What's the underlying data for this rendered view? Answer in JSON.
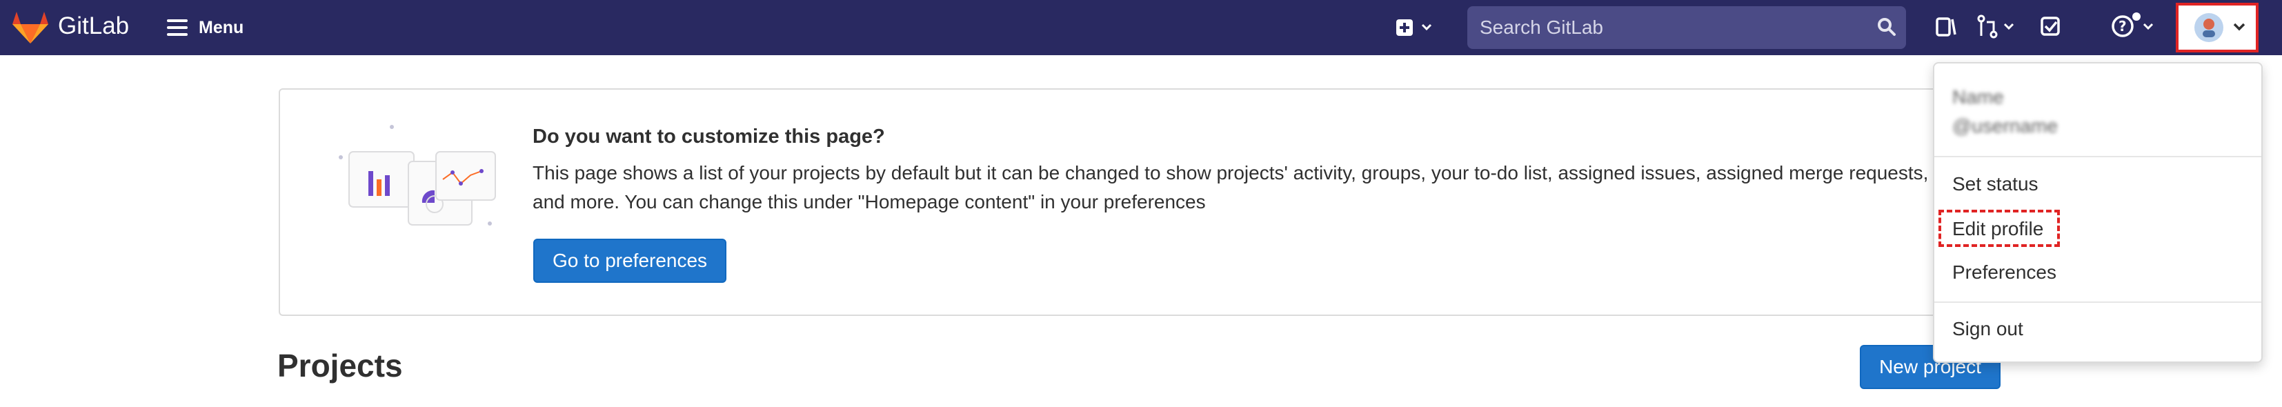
{
  "topbar": {
    "logo_text": "GitLab",
    "menu_label": "Menu",
    "search_placeholder": "Search GitLab"
  },
  "banner": {
    "title": "Do you want to customize this page?",
    "body": "This page shows a list of your projects by default but it can be changed to show projects' activity, groups, your to-do list, assigned issues, assigned merge requests, and more. You can change this under \"Homepage content\" in your preferences",
    "button_label": "Go to preferences"
  },
  "main": {
    "projects_title": "Projects",
    "new_project_label": "New project"
  },
  "user_dropdown": {
    "name": "Name",
    "username": "@username",
    "items": [
      "Set status",
      "Edit profile",
      "Preferences",
      "Sign out"
    ]
  },
  "colors": {
    "topbar": "#292961",
    "primary": "#1f75cb",
    "highlight": "#e02424"
  }
}
